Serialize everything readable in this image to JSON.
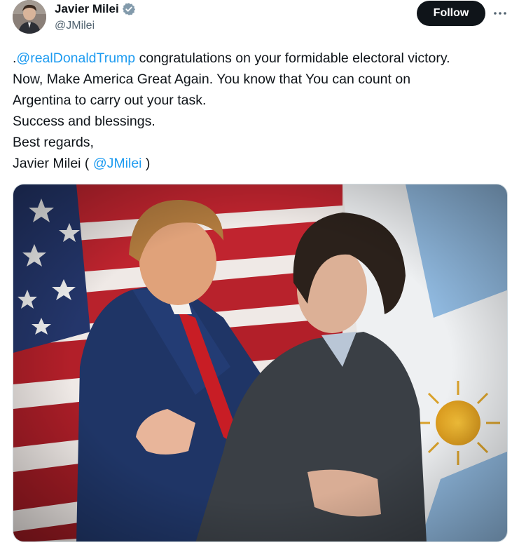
{
  "author": {
    "display_name": "Javier Milei",
    "handle": "@JMilei",
    "verified_icon": "verified-badge-icon"
  },
  "actions": {
    "follow_label": "Follow",
    "more_icon": "more-horizontal-icon"
  },
  "tweet": {
    "line1_prefix": ".",
    "line1_mention": "@realDonaldTrump",
    "line1_rest": " congratulations on your formidable electoral victory.",
    "line2": "Now, Make America Great Again. You know that You can count on",
    "line3": "Argentina to carry out your task.",
    "line4": "Success and blessings.",
    "line5": "Best regards,",
    "line6_prefix": "Javier Milei ( ",
    "line6_mention": "@JMilei",
    "line6_suffix": " )"
  },
  "colors": {
    "link": "#1d9bf0",
    "follow_bg": "#0f1419",
    "handle_gray": "#536471"
  }
}
